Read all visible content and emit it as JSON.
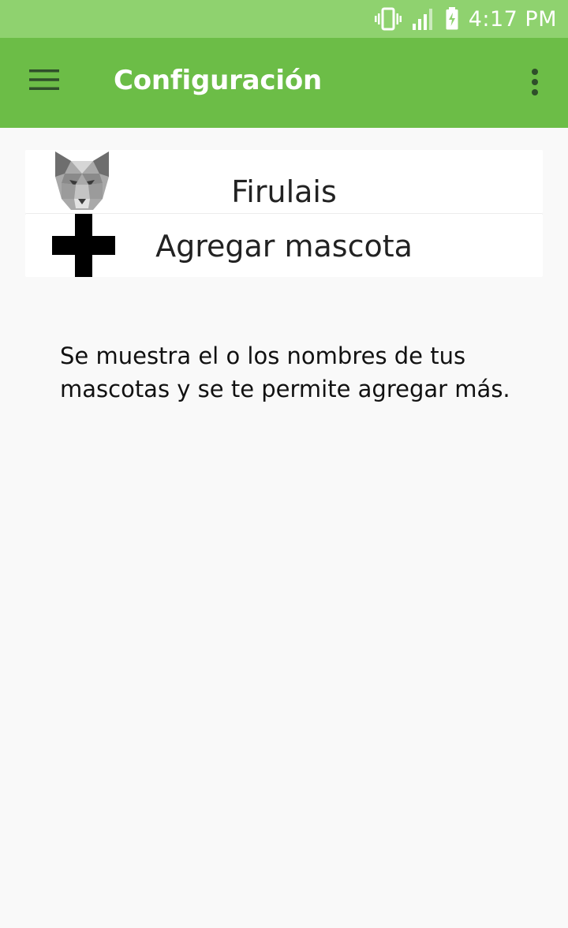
{
  "status_bar": {
    "time": "4:17 PM",
    "icons": [
      "vibrate-icon",
      "signal-icon",
      "battery-charging-icon"
    ]
  },
  "app_bar": {
    "title": "Configuración",
    "menu_icon": "hamburger-menu-icon",
    "overflow_icon": "more-vertical-icon"
  },
  "pets": {
    "items": [
      {
        "name": "Firulais",
        "icon": "wolf-avatar-icon"
      }
    ],
    "add_label": "Agregar mascota",
    "add_icon": "plus-icon"
  },
  "help": {
    "text": "Se muestra el o los nombres de tus mascotas y se te permite agregar más."
  },
  "colors": {
    "status_bar": "#8fd26f",
    "app_bar": "#6cbd47",
    "background": "#f9f9f9",
    "app_bar_icons": "#2f4f2a"
  }
}
